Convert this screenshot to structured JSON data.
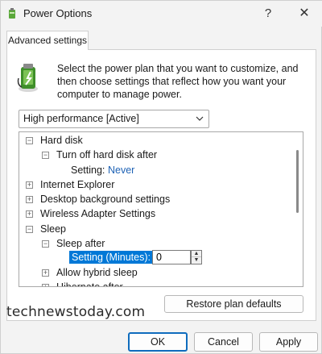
{
  "window": {
    "title": "Power Options",
    "help_label": "?",
    "close_label": "✕"
  },
  "tabs": [
    {
      "label": "Advanced settings",
      "active": true
    }
  ],
  "description": "Select the power plan that you want to customize, and then choose settings that reflect how you want your computer to manage power.",
  "plan_select": {
    "value": "High performance [Active]"
  },
  "tree": {
    "items": [
      {
        "label": "Hard disk",
        "expander": "⊟"
      },
      {
        "label": "Turn off hard disk after",
        "expander": "⊟"
      },
      {
        "label_prefix": "Setting:",
        "value": "Never"
      },
      {
        "label": "Internet Explorer",
        "expander": "⊞"
      },
      {
        "label": "Desktop background settings",
        "expander": "⊞"
      },
      {
        "label": "Wireless Adapter Settings",
        "expander": "⊞"
      },
      {
        "label": "Sleep",
        "expander": "⊟"
      },
      {
        "label": "Sleep after",
        "expander": "⊟"
      },
      {
        "label": "Setting (Minutes):",
        "value": "0"
      },
      {
        "label": "Allow hybrid sleep",
        "expander": "⊞"
      },
      {
        "label": "Hibernate after",
        "expander": "⊞"
      }
    ]
  },
  "watermark": "technewstoday.com",
  "buttons": {
    "restore": "Restore plan defaults",
    "ok": "OK",
    "cancel": "Cancel",
    "apply": "Apply"
  },
  "colors": {
    "accent": "#0078d7",
    "link": "#1e62b5",
    "default_button_border": "#0f6cbd"
  }
}
